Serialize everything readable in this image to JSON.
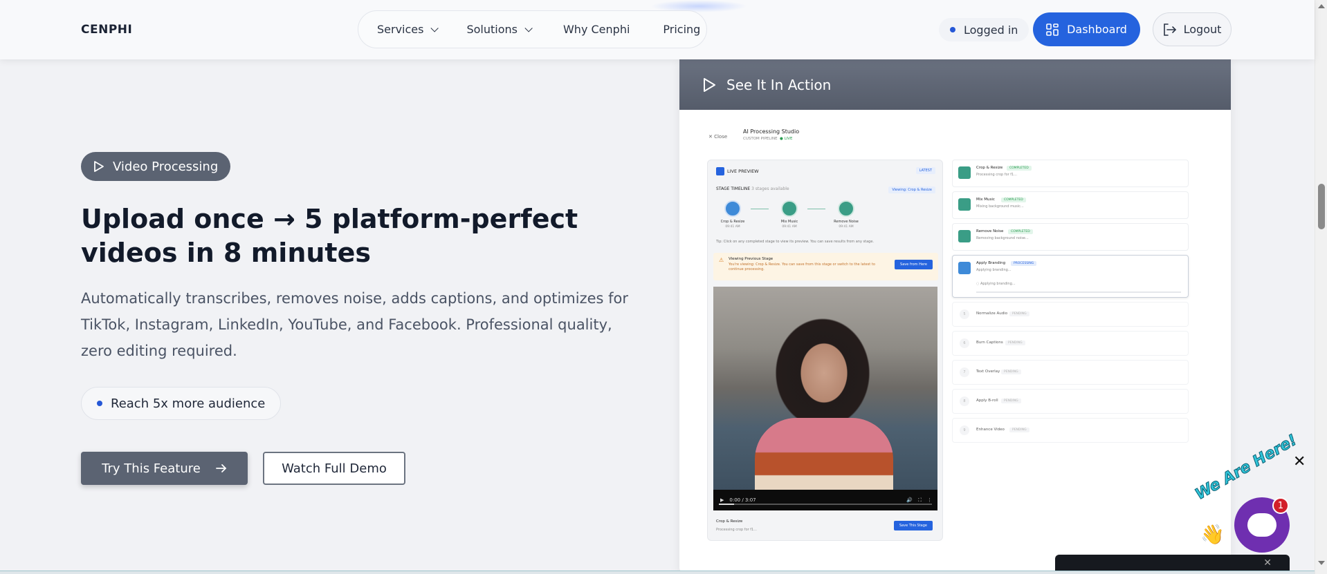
{
  "nav": {
    "logo": "CENPHI",
    "items": [
      {
        "label": "Services",
        "dropdown": true
      },
      {
        "label": "Solutions",
        "dropdown": true
      },
      {
        "label": "Why Cenphi",
        "dropdown": false
      },
      {
        "label": "Pricing",
        "dropdown": false
      }
    ],
    "status": "Logged in",
    "dashboard_label": "Dashboard",
    "logout_label": "Logout"
  },
  "hero": {
    "badge": "Video Processing",
    "headline": "Upload once → 5 platform-perfect videos in 8 minutes",
    "subtitle": "Automatically transcribes, removes noise, adds captions, and optimizes for TikTok, Instagram, LinkedIn, YouTube, and Facebook. Professional quality, zero editing required.",
    "highlight": "Reach 5x more audience",
    "primary_cta": "Try This Feature",
    "secondary_cta": "Watch Full Demo"
  },
  "demo": {
    "header": "See It In Action",
    "close_label": "Close",
    "studio_title": "AI Processing Studio",
    "studio_subtitle": "CUSTOM PIPELINE",
    "live_label": "● LIVE",
    "preview_title": "LIVE PREVIEW",
    "latest_badge": "LATEST",
    "timeline_title": "STAGE TIMELINE",
    "timeline_count": "3 stages available",
    "viewing_badge": "Viewing: Crop & Resize",
    "stages": [
      {
        "label": "Crop & Resize",
        "time": "09:41 AM"
      },
      {
        "label": "Mix Music",
        "time": "09:41 AM"
      },
      {
        "label": "Remove Noise",
        "time": "09:41 AM"
      }
    ],
    "tip": "Tip: Click on any completed stage to view its preview. You can save results from any stage.",
    "warning_title": "Viewing Previous Stage",
    "warning_text": "You're viewing: Crop & Resize. You can save from this stage or switch to the latest to continue processing.",
    "save_from_here": "Save from Here",
    "video_time": "0:00 / 3:07",
    "footer_stage": "Crop & Resize",
    "footer_desc": "Processing crop for f1...",
    "save_stage": "Save This Stage",
    "steps": [
      {
        "name": "Crop & Resize",
        "status": "COMPLETED",
        "desc": "Processing crop for f1..."
      },
      {
        "name": "Mix Music",
        "status": "COMPLETED",
        "desc": "Mixing background music..."
      },
      {
        "name": "Remove Noise",
        "status": "COMPLETED",
        "desc": "Removing background noise..."
      },
      {
        "name": "Apply Branding",
        "status": "PROCESSING",
        "desc": "Applying branding...",
        "desc2": "Applying branding..."
      },
      {
        "num": "5",
        "name": "Normalize Audio",
        "status": "PENDING"
      },
      {
        "num": "6",
        "name": "Burn Captions",
        "status": "PENDING"
      },
      {
        "num": "7",
        "name": "Text Overlay",
        "status": "PENDING"
      },
      {
        "num": "8",
        "name": "Apply B-roll",
        "status": "PENDING"
      },
      {
        "num": "9",
        "name": "Enhance Video",
        "status": "PENDING"
      }
    ]
  },
  "chat": {
    "tagline": "We Are Here!",
    "badge_count": "1"
  },
  "colors": {
    "primary": "#2563de",
    "slate": "#5b6372",
    "success": "#2a9d50",
    "chat": "#6f2fb0"
  }
}
